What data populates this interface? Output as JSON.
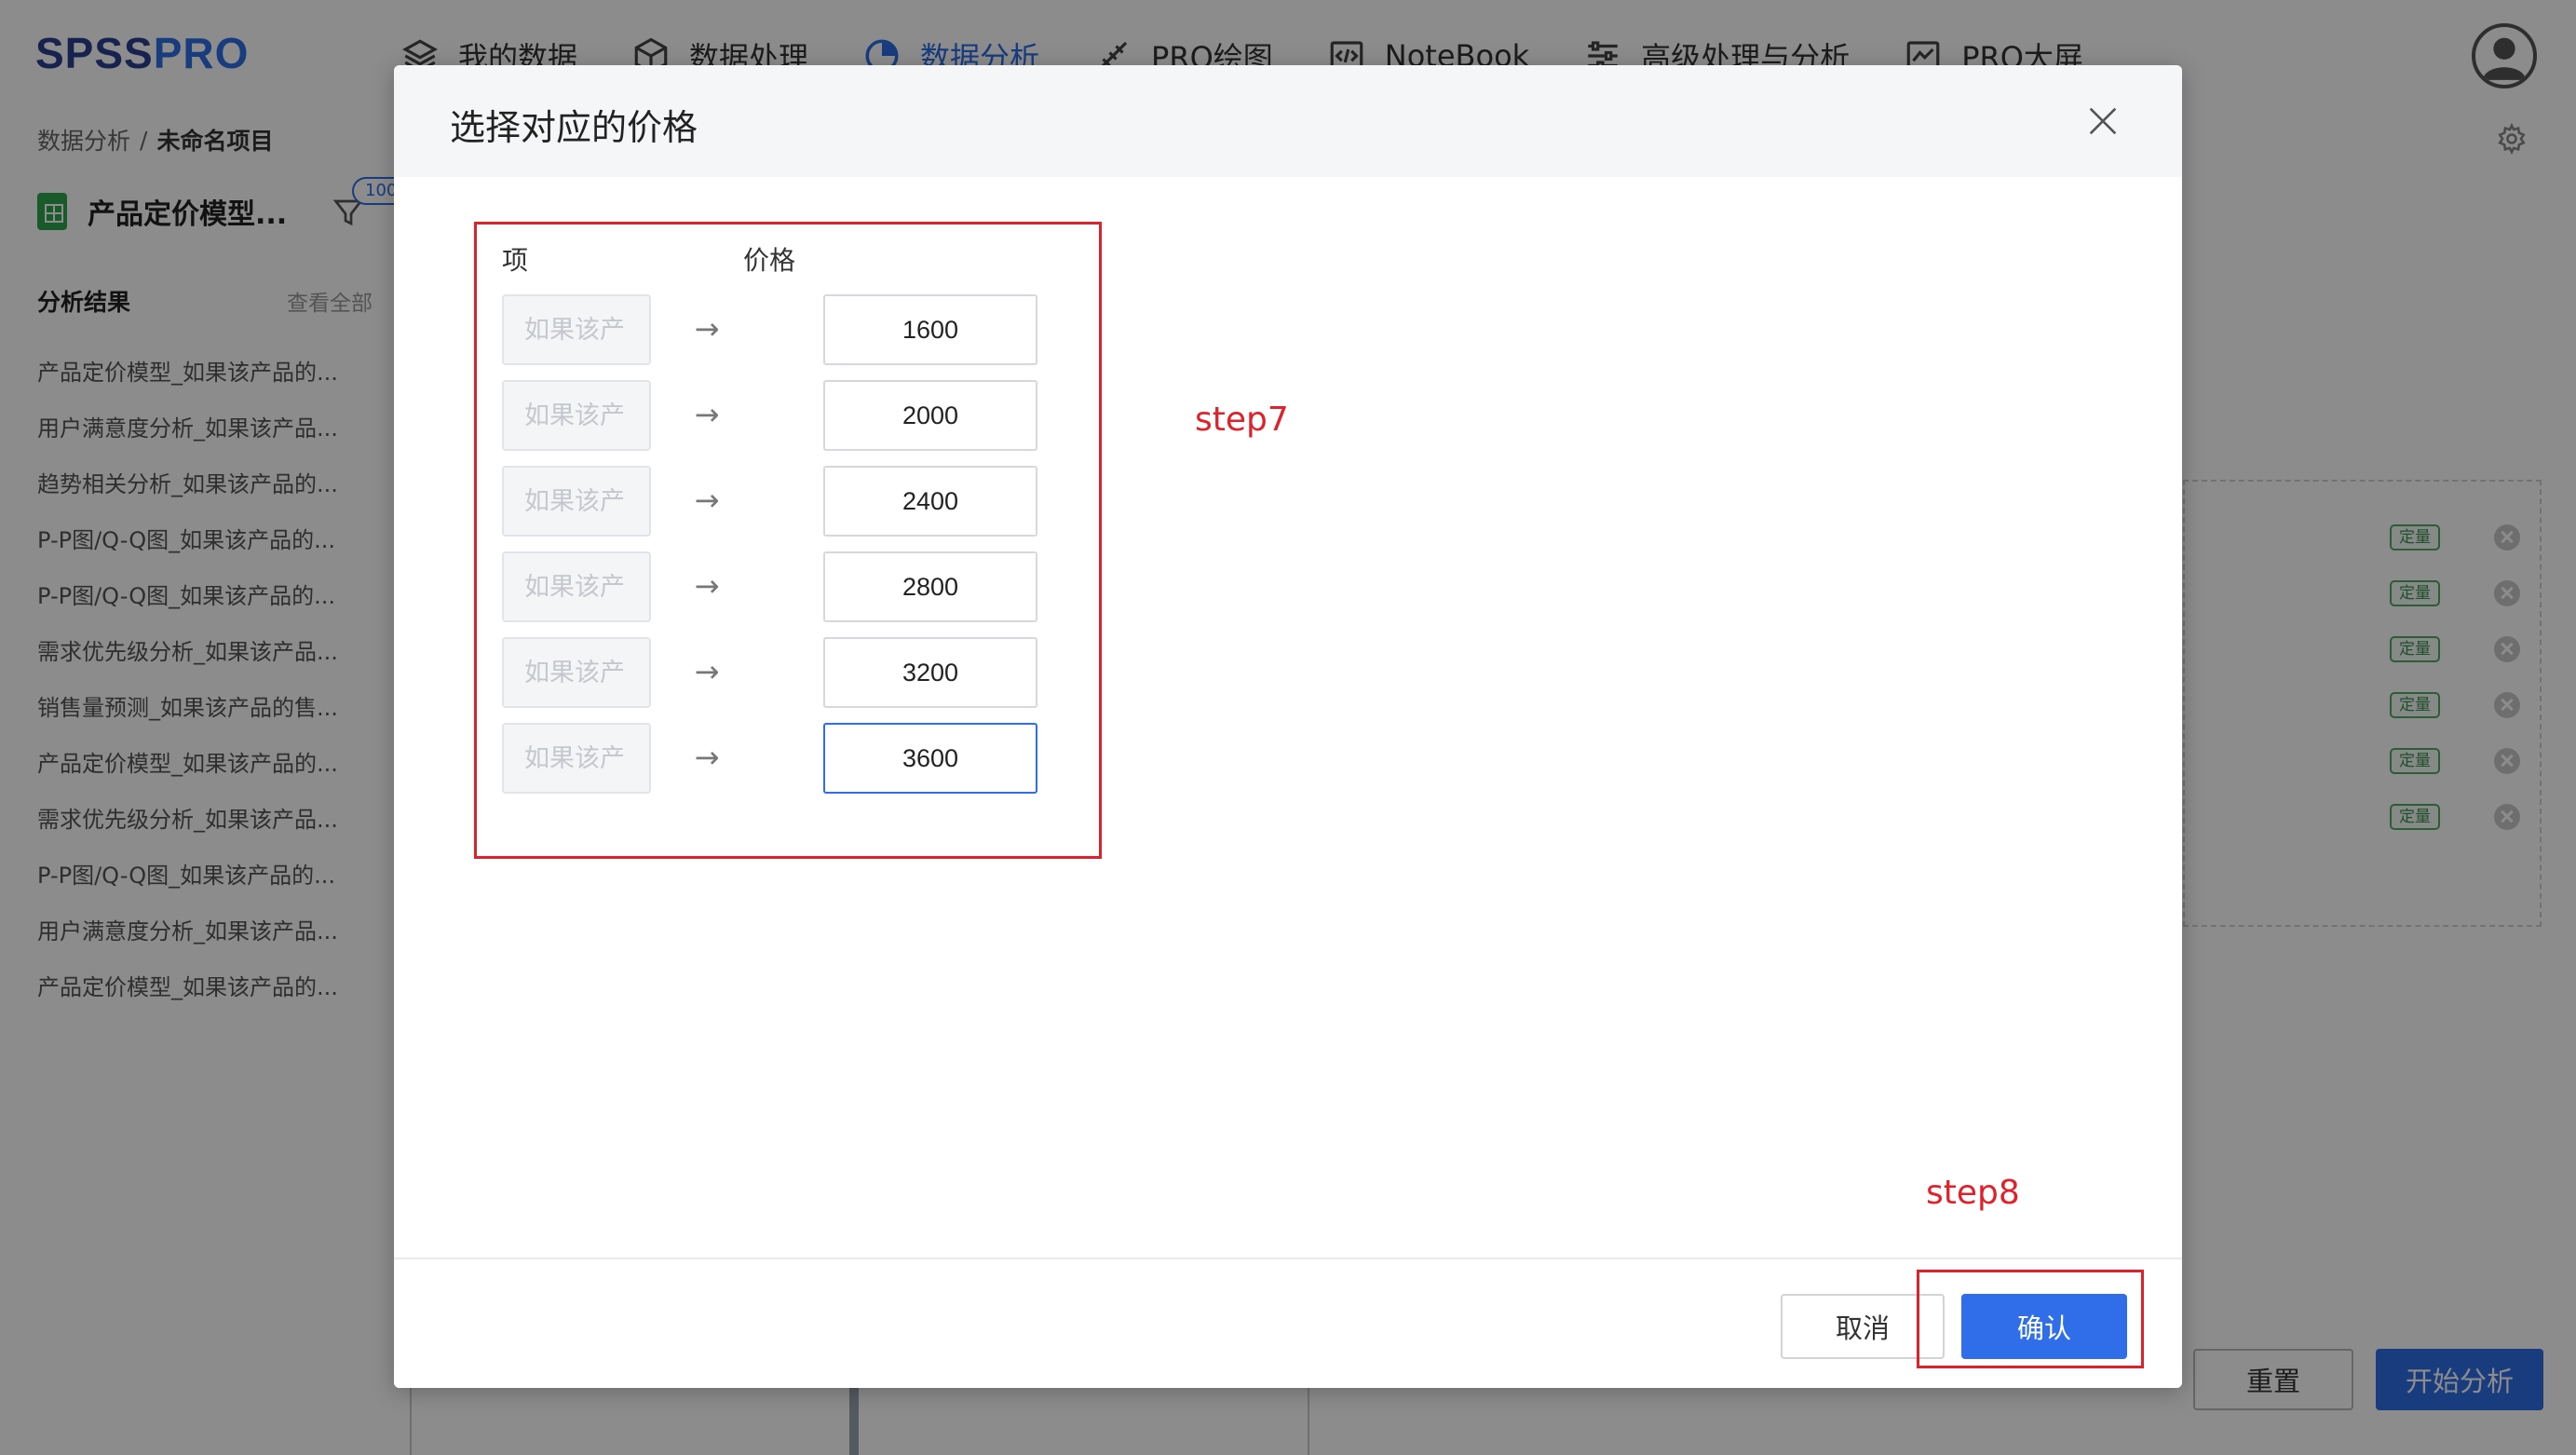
{
  "app": {
    "logo": {
      "main": "SPSS",
      "accent": "PRO"
    },
    "nav": [
      {
        "label": "我的数据",
        "icon": "layers-icon",
        "active": false
      },
      {
        "label": "数据处理",
        "icon": "cube-icon",
        "active": false
      },
      {
        "label": "数据分析",
        "icon": "pie-chart-icon",
        "active": true
      },
      {
        "label": "PRO绘图",
        "icon": "pen-ruler-icon",
        "active": false
      },
      {
        "label": "NoteBook",
        "icon": "code-icon",
        "active": false
      },
      {
        "label": "高级处理与分析",
        "icon": "sliders-icon",
        "active": false
      },
      {
        "label": "PRO大屏",
        "icon": "line-chart-icon",
        "active": false
      }
    ],
    "accent_color": "#2f6ee8",
    "brand_color": "#2a3f8f"
  },
  "breadcrumb": {
    "parent": "数据分析",
    "separator": "/",
    "current": "未命名项目"
  },
  "file": {
    "name": "产品定价模型...",
    "filter_badge": "100"
  },
  "sidebar": {
    "title": "分析结果",
    "more": "查看全部",
    "items": [
      "产品定价模型_如果该产品的...",
      "用户满意度分析_如果该产品...",
      "趋势相关分析_如果该产品的...",
      "P-P图/Q-Q图_如果该产品的...",
      "P-P图/Q-Q图_如果该产品的...",
      "需求优先级分析_如果该产品...",
      "销售量预测_如果该产品的售...",
      "产品定价模型_如果该产品的...",
      "需求优先级分析_如果该产品...",
      "P-P图/Q-Q图_如果该产品的...",
      "用户满意度分析_如果该产品...",
      "产品定价模型_如果该产品的..."
    ]
  },
  "variables_panel": {
    "tag_label": "定量",
    "count": 6
  },
  "actions": {
    "reset": "重置",
    "start": "开始分析"
  },
  "modal": {
    "title": "选择对应的价格",
    "column_item": "项",
    "column_price": "价格",
    "rows": [
      {
        "item_placeholder": "如果该产",
        "price": "1600"
      },
      {
        "item_placeholder": "如果该产",
        "price": "2000"
      },
      {
        "item_placeholder": "如果该产",
        "price": "2400"
      },
      {
        "item_placeholder": "如果该产",
        "price": "2800"
      },
      {
        "item_placeholder": "如果该产",
        "price": "3200"
      },
      {
        "item_placeholder": "如果该产",
        "price": "3600"
      }
    ],
    "arrow": "→",
    "cancel": "取消",
    "confirm": "确认"
  },
  "annotations": {
    "step7": "step7",
    "step8": "step8",
    "color": "#e0212a"
  }
}
